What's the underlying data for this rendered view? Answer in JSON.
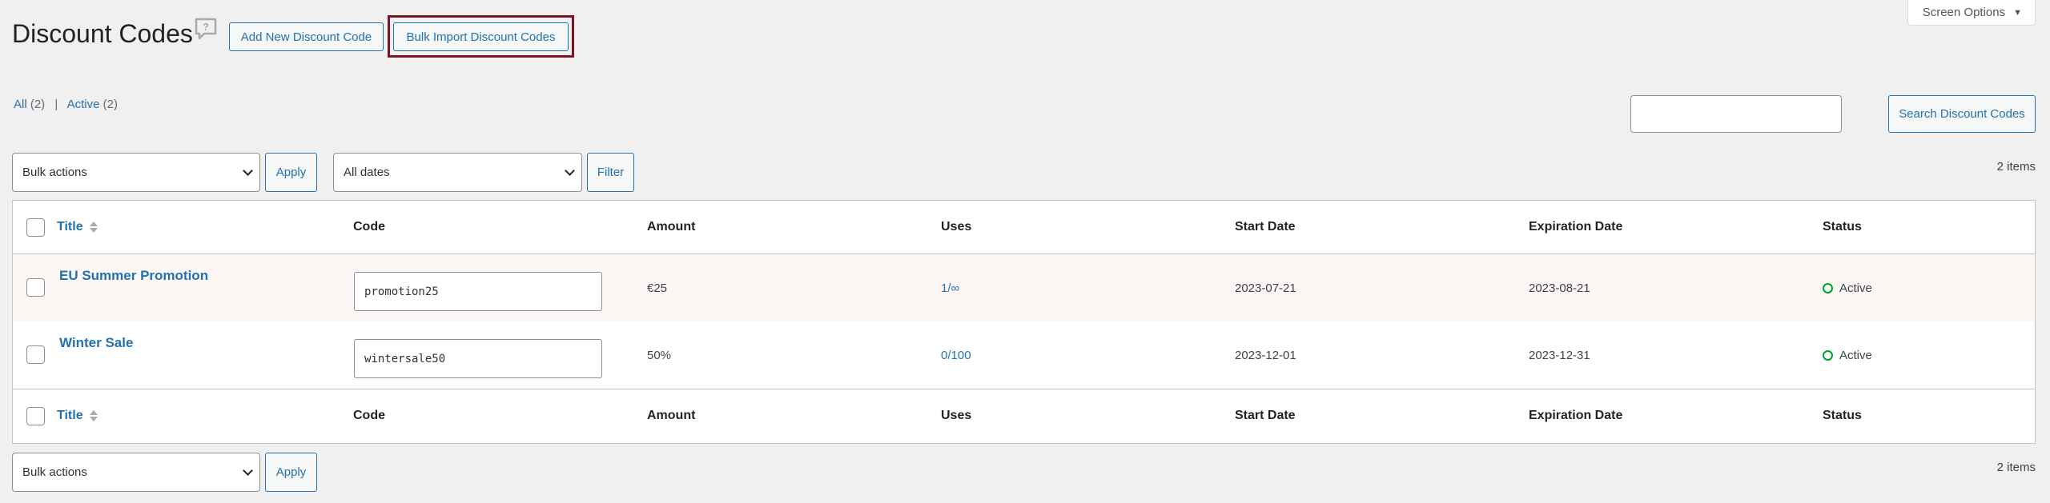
{
  "header": {
    "title": "Discount Codes",
    "add_new_label": "Add New Discount Code",
    "bulk_import_label": "Bulk Import Discount Codes",
    "screen_options_label": "Screen Options"
  },
  "filters": {
    "all_label": "All",
    "all_count": "(2)",
    "active_label": "Active",
    "active_count": "(2)",
    "separator": "|"
  },
  "search": {
    "value": "",
    "button_label": "Search Discount Codes"
  },
  "tablenav_top": {
    "bulk_actions": "Bulk actions",
    "apply_label": "Apply",
    "dates": "All dates",
    "filter_label": "Filter",
    "items_count": "2 items"
  },
  "table": {
    "columns": [
      "Title",
      "Code",
      "Amount",
      "Uses",
      "Start Date",
      "Expiration Date",
      "Status"
    ],
    "rows": [
      {
        "title": "EU Summer Promotion",
        "code": "promotion25",
        "amount": "€25",
        "uses": "1/∞",
        "start_date": "2023-07-21",
        "expiration_date": "2023-08-21",
        "status": "Active"
      },
      {
        "title": "Winter Sale",
        "code": "wintersale50",
        "amount": "50%",
        "uses": "0/100",
        "start_date": "2023-12-01",
        "expiration_date": "2023-12-31",
        "status": "Active"
      }
    ]
  },
  "tablenav_bottom": {
    "bulk_actions": "Bulk actions",
    "apply_label": "Apply",
    "items_count": "2 items"
  },
  "colors": {
    "accent": "#2271b1",
    "highlight_border": "#7a1424",
    "status_active": "#00a32a",
    "background": "#f0f0f1"
  }
}
